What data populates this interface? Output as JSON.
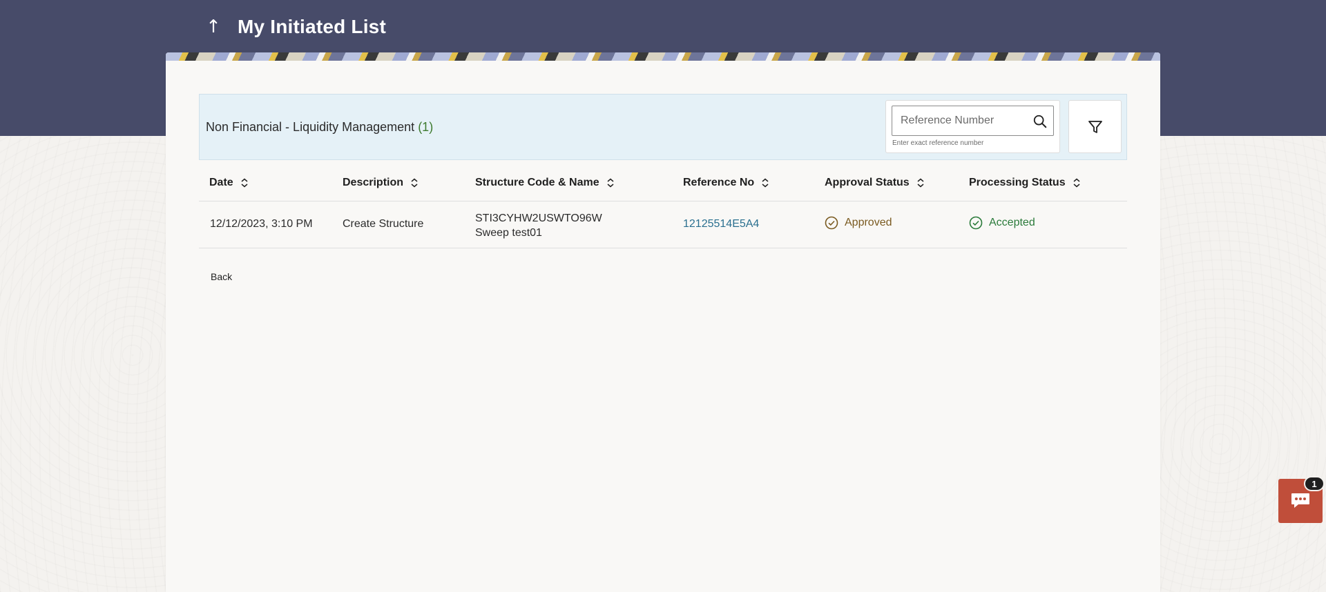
{
  "header": {
    "back_arrow": "↑",
    "title": "My Initiated List"
  },
  "panel": {
    "title": "Non Financial - Liquidity Management",
    "count": "(1)",
    "search": {
      "placeholder": "Reference Number",
      "value": "",
      "hint": "Enter exact reference number"
    }
  },
  "table": {
    "columns": [
      "Date",
      "Description",
      "Structure Code & Name",
      "Reference No",
      "Approval Status",
      "Processing Status"
    ],
    "rows": [
      {
        "date": "12/12/2023, 3:10 PM",
        "description": "Create Structure",
        "structure_code": "STI3CYHW2USWTO96W",
        "structure_name": "Sweep test01",
        "reference_no": "12125514E5A4",
        "approval_status": "Approved",
        "processing_status": "Accepted"
      }
    ]
  },
  "footer": {
    "back_label": "Back"
  },
  "chat": {
    "badge": "1"
  },
  "colors": {
    "top_band": "#474b69",
    "panel_bg": "#e5f1f7",
    "link": "#2a6f8f",
    "approved": "#7a5a20",
    "accepted": "#2a7a3a",
    "chat_button": "#c04e3a"
  },
  "icons": {
    "search": "search-icon",
    "filter": "filter-icon",
    "sort": "sort-icon",
    "approved": "check-circle-icon",
    "accepted": "check-circle-icon",
    "chat": "chat-bubble-icon"
  }
}
